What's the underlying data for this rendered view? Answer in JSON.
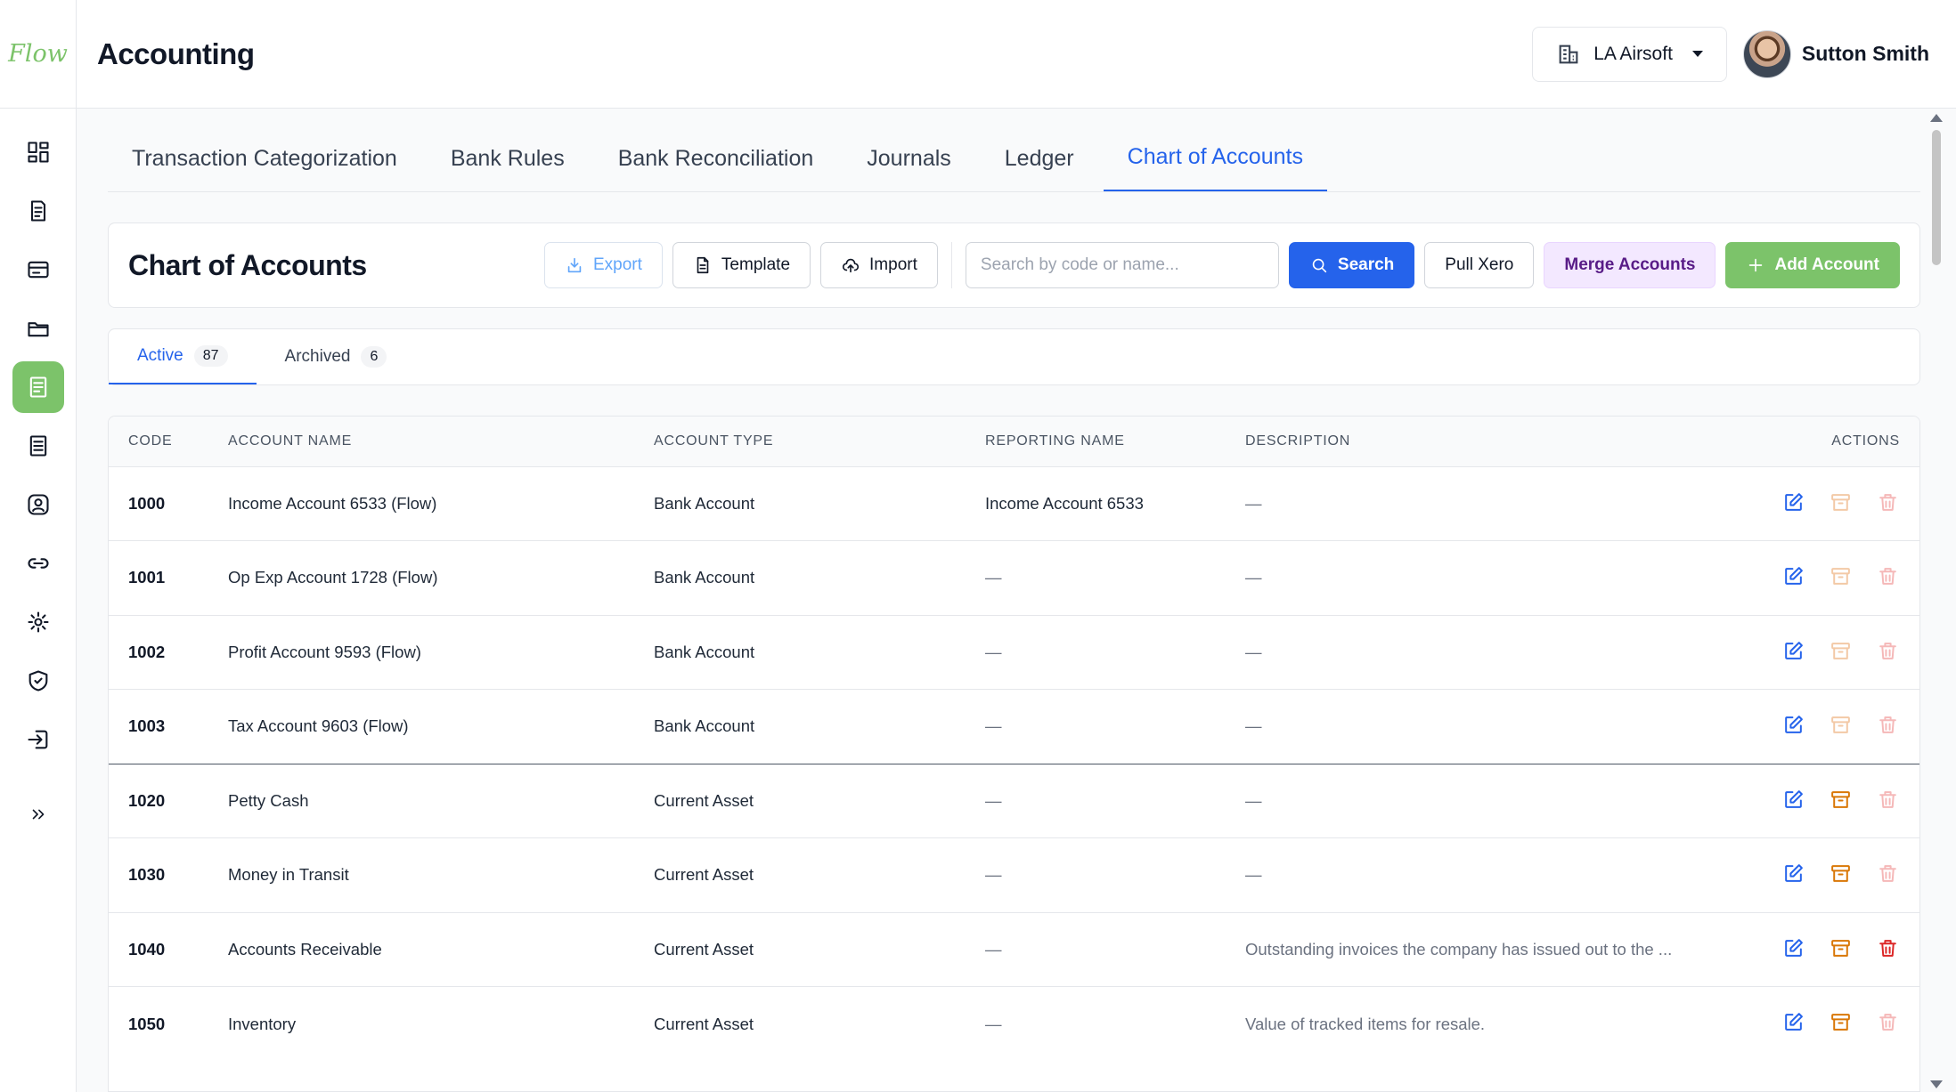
{
  "sidebar": {
    "logo": "Flow",
    "items": [
      {
        "name": "dashboard",
        "icon": "dashboard-icon"
      },
      {
        "name": "invoices",
        "icon": "receipt-icon"
      },
      {
        "name": "billing",
        "icon": "card-icon"
      },
      {
        "name": "documents",
        "icon": "folder-icon"
      },
      {
        "name": "accounting",
        "icon": "ledger-icon",
        "active": true
      },
      {
        "name": "reports",
        "icon": "document-icon"
      },
      {
        "name": "contacts",
        "icon": "contact-icon"
      },
      {
        "name": "integrations",
        "icon": "link-icon"
      },
      {
        "name": "settings",
        "icon": "gear-icon"
      },
      {
        "name": "security",
        "icon": "shield-icon"
      },
      {
        "name": "logout",
        "icon": "sign-in-icon"
      },
      {
        "name": "expand",
        "icon": "double-chevron-right-icon"
      }
    ]
  },
  "header": {
    "title": "Accounting",
    "organization": "LA Airsoft",
    "user_name": "Sutton Smith"
  },
  "tabs": [
    {
      "label": "Transaction Categorization"
    },
    {
      "label": "Bank Rules"
    },
    {
      "label": "Bank Reconciliation"
    },
    {
      "label": "Journals"
    },
    {
      "label": "Ledger"
    },
    {
      "label": "Chart of Accounts",
      "active": true
    }
  ],
  "toolbar": {
    "title": "Chart of Accounts",
    "export_label": "Export",
    "template_label": "Template",
    "import_label": "Import",
    "search_placeholder": "Search by code or name...",
    "search_value": "",
    "search_label": "Search",
    "pull_xero_label": "Pull Xero",
    "merge_label": "Merge Accounts",
    "add_label": "Add Account"
  },
  "subtabs": {
    "active_label": "Active",
    "active_count": "87",
    "archived_label": "Archived",
    "archived_count": "6"
  },
  "table": {
    "headers": {
      "code": "CODE",
      "name": "ACCOUNT NAME",
      "type": "ACCOUNT TYPE",
      "reporting": "REPORTING NAME",
      "description": "DESCRIPTION",
      "actions": "ACTIONS"
    },
    "rows": [
      {
        "code": "1000",
        "name": "Income Account 6533 (Flow)",
        "type": "Bank Account",
        "reporting": "Income Account 6533",
        "description": "—",
        "archive_enabled": false,
        "delete_enabled": false
      },
      {
        "code": "1001",
        "name": "Op Exp Account 1728 (Flow)",
        "type": "Bank Account",
        "reporting": "—",
        "description": "—",
        "archive_enabled": false,
        "delete_enabled": false
      },
      {
        "code": "1002",
        "name": "Profit Account 9593 (Flow)",
        "type": "Bank Account",
        "reporting": "—",
        "description": "—",
        "archive_enabled": false,
        "delete_enabled": false
      },
      {
        "code": "1003",
        "name": "Tax Account 9603 (Flow)",
        "type": "Bank Account",
        "reporting": "—",
        "description": "—",
        "archive_enabled": false,
        "delete_enabled": false
      },
      {
        "code": "1020",
        "name": "Petty Cash",
        "type": "Current Asset",
        "reporting": "—",
        "description": "—",
        "archive_enabled": true,
        "delete_enabled": false
      },
      {
        "code": "1030",
        "name": "Money in Transit",
        "type": "Current Asset",
        "reporting": "—",
        "description": "—",
        "archive_enabled": true,
        "delete_enabled": false
      },
      {
        "code": "1040",
        "name": "Accounts Receivable",
        "type": "Current Asset",
        "reporting": "—",
        "description": "Outstanding invoices the company has issued out to the ...",
        "archive_enabled": true,
        "delete_enabled": true
      },
      {
        "code": "1050",
        "name": "Inventory",
        "type": "Current Asset",
        "reporting": "—",
        "description": "Value of tracked items for resale.",
        "archive_enabled": true,
        "delete_enabled": false
      }
    ]
  },
  "colors": {
    "brand_green": "#7cc36a",
    "primary_blue": "#2563eb",
    "merge_purple_bg": "#f3e8ff",
    "archive_orange": "#d97706",
    "delete_red": "#dc2626"
  }
}
